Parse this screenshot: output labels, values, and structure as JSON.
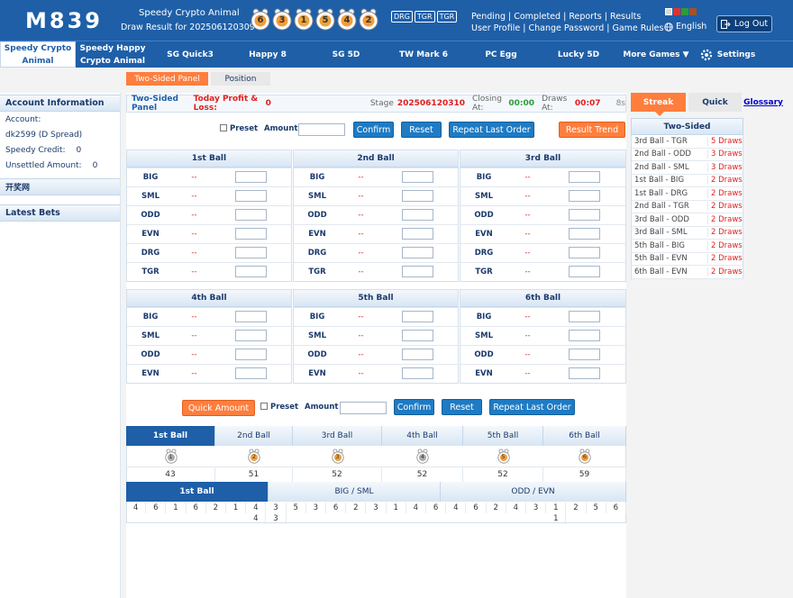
{
  "header": {
    "logo": "M839",
    "game_name": "Speedy Crypto Animal",
    "draw_result": "Draw Result for 202506120309",
    "balls": [
      "6",
      "3",
      "1",
      "5",
      "4",
      "2"
    ],
    "badges": [
      "DRG",
      "TGR",
      "TGR"
    ],
    "links_row1": [
      "Pending",
      "Completed",
      "Reports",
      "Results"
    ],
    "links_row2": [
      "User Profile",
      "Change Password",
      "Game Rules"
    ],
    "language": "English",
    "logout": "Log Out"
  },
  "nav": {
    "items": [
      {
        "label": "Speedy Crypto Animal"
      },
      {
        "label": "Speedy Happy Crypto Animal"
      },
      {
        "label": "SG Quick3"
      },
      {
        "label": "Happy 8"
      },
      {
        "label": "SG 5D"
      },
      {
        "label": "TW Mark 6"
      },
      {
        "label": "PC Egg"
      },
      {
        "label": "Lucky 5D"
      },
      {
        "label": "More Games ▼"
      },
      {
        "label": "Settings"
      }
    ]
  },
  "subtabs": {
    "two_sided": "Two-Sided Panel",
    "position": "Position"
  },
  "sidebar": {
    "account_title": "Account Information",
    "account_label": "Account:",
    "account_value": "dk2599 (D Spread)",
    "credit_label": "Speedy Credit:",
    "credit_value": "0",
    "unsettled_label": "Unsettled Amount:",
    "unsettled_value": "0",
    "draw_site": "开奖网",
    "latest_bets": "Latest Bets"
  },
  "panel": {
    "title": "Two-Sided Panel",
    "profit_label": "Today Profit & Loss:",
    "profit_value": "0",
    "stage_label": "Stage",
    "stage_value": "202506120310",
    "closing_label": "Closing At:",
    "closing_value": "00:00",
    "draws_label": "Draws At:",
    "draws_value": "00:07",
    "refresh": "8s",
    "preset": "Preset",
    "amount": "Amount",
    "confirm": "Confirm",
    "reset": "Reset",
    "repeat": "Repeat Last Order",
    "result_trend": "Result Trend",
    "quick_amount": "Quick Amount"
  },
  "odds_placeholder": "--",
  "balls_top": [
    {
      "title": "1st Ball",
      "rows": [
        "BIG",
        "SML",
        "ODD",
        "EVN",
        "DRG",
        "TGR"
      ]
    },
    {
      "title": "2nd Ball",
      "rows": [
        "BIG",
        "SML",
        "ODD",
        "EVN",
        "DRG",
        "TGR"
      ]
    },
    {
      "title": "3rd Ball",
      "rows": [
        "BIG",
        "SML",
        "ODD",
        "EVN",
        "DRG",
        "TGR"
      ]
    }
  ],
  "balls_bottom": [
    {
      "title": "4th Ball",
      "rows": [
        "BIG",
        "SML",
        "ODD",
        "EVN"
      ]
    },
    {
      "title": "5th Ball",
      "rows": [
        "BIG",
        "SML",
        "ODD",
        "EVN"
      ]
    },
    {
      "title": "6th Ball",
      "rows": [
        "BIG",
        "SML",
        "ODD",
        "EVN"
      ]
    }
  ],
  "stats": {
    "tabs": [
      "1st Ball",
      "2nd Ball",
      "3rd Ball",
      "4th Ball",
      "5th Ball",
      "6th Ball"
    ],
    "icons": [
      "1",
      "2",
      "3",
      "4",
      "5",
      "6"
    ],
    "counts": [
      "43",
      "51",
      "52",
      "52",
      "52",
      "59"
    ]
  },
  "trend": {
    "tabs": [
      "1st Ball",
      "BIG / SML",
      "ODD / EVN"
    ],
    "columns": [
      [
        "4"
      ],
      [
        "6"
      ],
      [
        "1"
      ],
      [
        "6"
      ],
      [
        "2"
      ],
      [
        "1"
      ],
      [
        "4",
        "4"
      ],
      [
        "3",
        "3"
      ],
      [
        "5"
      ],
      [
        "3"
      ],
      [
        "6"
      ],
      [
        "2"
      ],
      [
        "3"
      ],
      [
        "1"
      ],
      [
        "4"
      ],
      [
        "6"
      ],
      [
        "4"
      ],
      [
        "6"
      ],
      [
        "2"
      ],
      [
        "4"
      ],
      [
        "3"
      ],
      [
        "1",
        "1"
      ],
      [
        "2"
      ],
      [
        "5"
      ],
      [
        "6"
      ]
    ]
  },
  "streak": {
    "tabs": [
      "Streak",
      "Quick",
      "Glossary"
    ],
    "title": "Two-Sided",
    "rows": [
      {
        "name": "3rd Ball - TGR",
        "draws": "5 Draws"
      },
      {
        "name": "2nd Ball - ODD",
        "draws": "3 Draws"
      },
      {
        "name": "2nd Ball - SML",
        "draws": "3 Draws"
      },
      {
        "name": "1st Ball - BIG",
        "draws": "2 Draws"
      },
      {
        "name": "1st Ball - DRG",
        "draws": "2 Draws"
      },
      {
        "name": "2nd Ball - TGR",
        "draws": "2 Draws"
      },
      {
        "name": "3rd Ball - ODD",
        "draws": "2 Draws"
      },
      {
        "name": "3rd Ball - SML",
        "draws": "2 Draws"
      },
      {
        "name": "5th Ball - BIG",
        "draws": "2 Draws"
      },
      {
        "name": "5th Ball - EVN",
        "draws": "2 Draws"
      },
      {
        "name": "6th Ball - EVN",
        "draws": "2 Draws"
      }
    ]
  },
  "colors": {
    "brand": "#1e5fa8",
    "accent": "#ff7e3d",
    "odds": "#e02020"
  }
}
